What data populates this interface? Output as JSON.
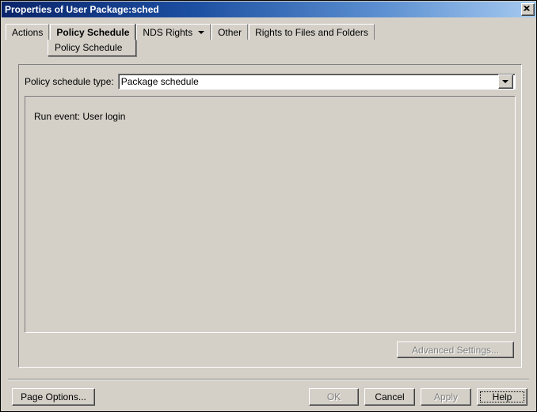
{
  "window": {
    "title": "Properties of User Package:sched",
    "close_icon": "close-icon"
  },
  "tabs": [
    {
      "label": "Actions",
      "selected": false,
      "has_dropdown": false
    },
    {
      "label": "Policy Schedule",
      "selected": true,
      "has_dropdown": false
    },
    {
      "label": "NDS Rights",
      "selected": false,
      "has_dropdown": true
    },
    {
      "label": "Other",
      "selected": false,
      "has_dropdown": false
    },
    {
      "label": "Rights to Files and Folders",
      "selected": false,
      "has_dropdown": false
    }
  ],
  "tab_menu": {
    "item_label": "Policy Schedule"
  },
  "panel": {
    "schedule_type_label": "Policy schedule type:",
    "schedule_type_value": "Package schedule",
    "dropdown_icon": "chevron-down-icon",
    "run_event_text": "Run event: User login"
  },
  "buttons": {
    "advanced_settings": {
      "label": "Advanced Settings...",
      "enabled": false,
      "focused": false
    },
    "page_options": {
      "label": "Page Options...",
      "enabled": true,
      "focused": false
    },
    "ok": {
      "label": "OK",
      "enabled": false,
      "focused": false
    },
    "cancel": {
      "label": "Cancel",
      "enabled": true,
      "focused": false
    },
    "apply": {
      "label": "Apply",
      "enabled": false,
      "focused": false
    },
    "help": {
      "label": "Help",
      "enabled": true,
      "focused": true
    }
  },
  "colors": {
    "face": "#d4d0c8",
    "title_gradient_start": "#0a246a",
    "title_gradient_end": "#a6caf0",
    "disabled_text": "#808080"
  }
}
